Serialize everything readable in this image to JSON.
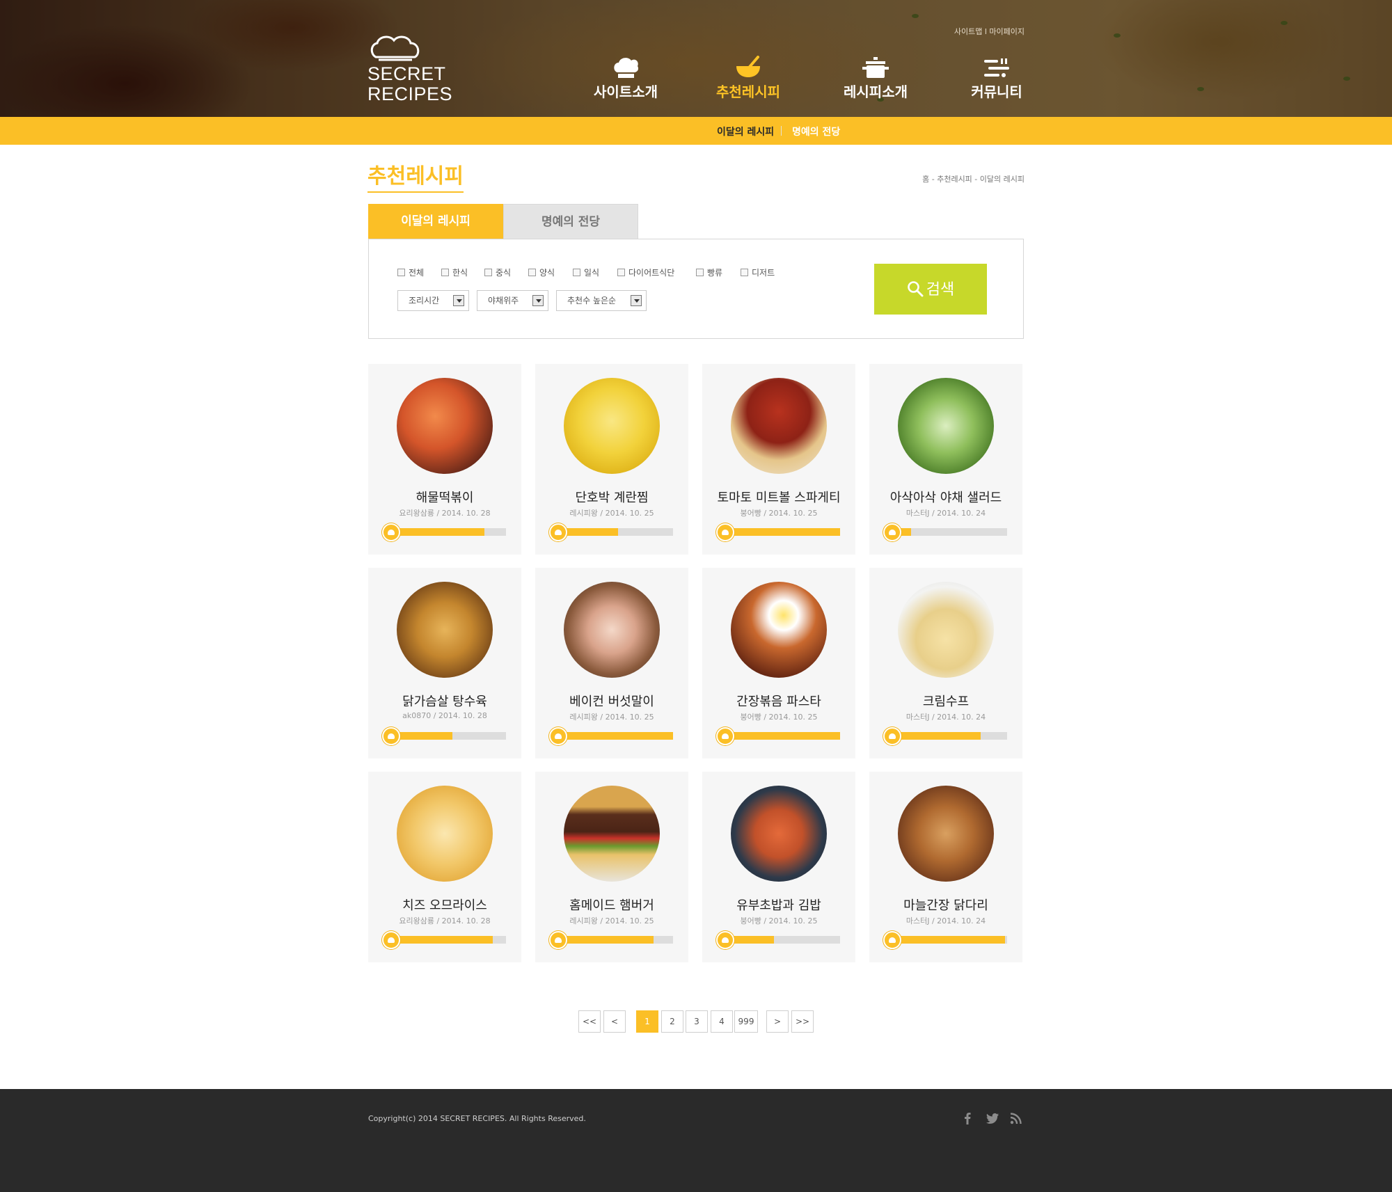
{
  "header": {
    "util_links": [
      "사이트맵",
      "마이페이지"
    ],
    "logo_lines": [
      "SECRET",
      "RECIPES"
    ],
    "nav": [
      {
        "label": "사이트소개",
        "icon": "chef-hat-icon",
        "active": false
      },
      {
        "label": "추천레시피",
        "icon": "mortar-bowl-icon",
        "active": true
      },
      {
        "label": "레시피소개",
        "icon": "cooking-pot-icon",
        "active": false
      },
      {
        "label": "커뮤니티",
        "icon": "utensils-icon",
        "active": false
      }
    ],
    "sub_nav": [
      "이달의 레시피",
      "명예의 전당"
    ]
  },
  "content": {
    "page_title": "추천레시피",
    "breadcrumb": "홈 - 추천레시피 - 이달의 레시피",
    "tabs": [
      "이달의 레시피",
      "명예의 전당"
    ],
    "filter": {
      "categories": [
        "전체",
        "한식",
        "중식",
        "양식",
        "일식",
        "다이어트식단",
        "빵류",
        "디저트"
      ],
      "selects": [
        "조리시간",
        "야채위주",
        "추천수 높은순"
      ],
      "search_label": "검색"
    }
  },
  "recipes": [
    {
      "title": "해물떡볶이",
      "meta": "요리왕삼룡 / 2014. 10. 28",
      "rating": 0.82
    },
    {
      "title": "단호박 계란찜",
      "meta": "레시피왕 / 2014. 10. 25",
      "rating": 0.54
    },
    {
      "title": "토마토 미트볼 스파게티",
      "meta": "붕어빵 / 2014. 10. 25",
      "rating": 1.0
    },
    {
      "title": "아삭아삭 야채 샐러드",
      "meta": "마스터J / 2014. 10. 24",
      "rating": 0.2
    },
    {
      "title": "닭가슴살 탕수육",
      "meta": "ak0870 / 2014. 10. 28",
      "rating": 0.55
    },
    {
      "title": "베이컨 버섯말이",
      "meta": "레시피왕 / 2014. 10. 25",
      "rating": 1.0
    },
    {
      "title": "간장볶음 파스타",
      "meta": "붕어빵 / 2014. 10. 25",
      "rating": 1.0
    },
    {
      "title": "크림수프",
      "meta": "마스터J / 2014. 10. 24",
      "rating": 0.78
    },
    {
      "title": "치즈 오므라이스",
      "meta": "요리왕삼룡 / 2014. 10. 28",
      "rating": 0.89
    },
    {
      "title": "홈메이드 햄버거",
      "meta": "레시피왕 / 2014. 10. 25",
      "rating": 0.84
    },
    {
      "title": "유부초밥과 김밥",
      "meta": "붕어빵 / 2014. 10. 25",
      "rating": 0.45
    },
    {
      "title": "마늘간장 닭다리",
      "meta": "마스터J / 2014. 10. 24",
      "rating": 0.98
    }
  ],
  "pagination": {
    "first": "<<",
    "prev": "<",
    "pages": [
      "1",
      "2",
      "3",
      "4",
      "999"
    ],
    "current": "1",
    "next": ">",
    "last": ">>"
  },
  "footer": {
    "copyright": "Copyright(c) 2014 SECRET RECIPES. All Rights Reserved.",
    "sns": [
      "facebook-icon",
      "twitter-icon",
      "rss-icon"
    ]
  },
  "colors": {
    "accent": "#fbbf26",
    "search_button": "#c7d82a",
    "footer_bg": "#2a2a2a",
    "card_bg": "#f6f6f6"
  }
}
